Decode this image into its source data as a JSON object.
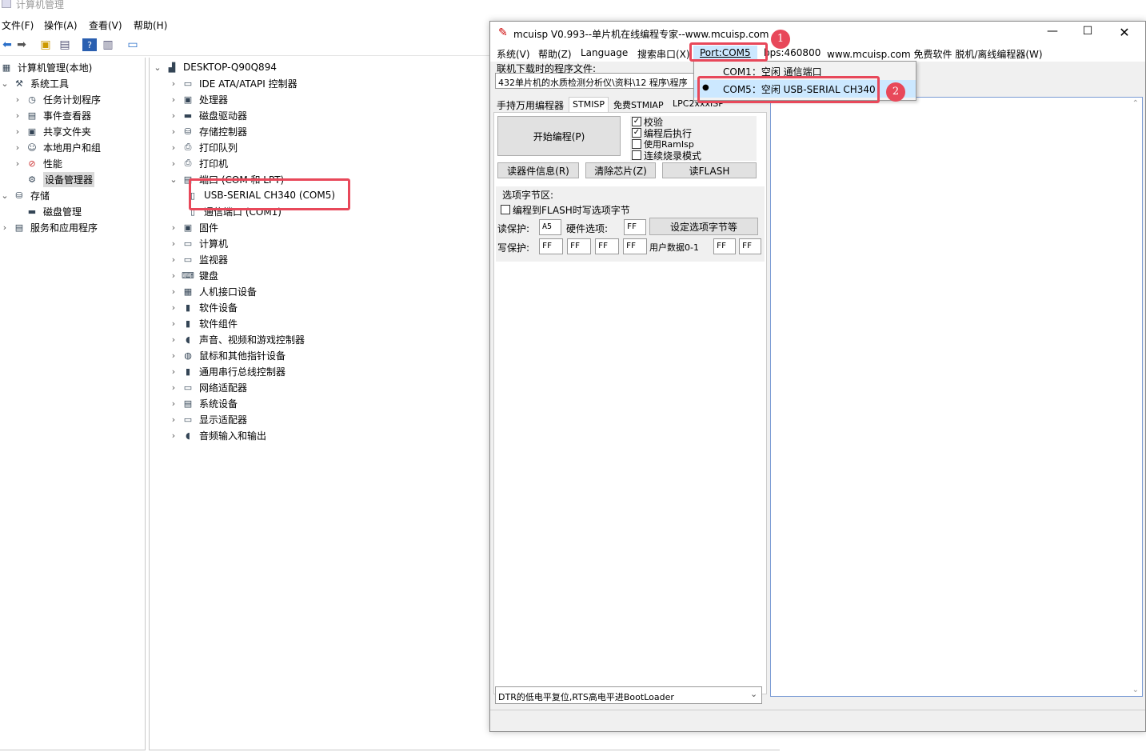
{
  "cm": {
    "title": "计算机管理",
    "menu": [
      "文件(F)",
      "操作(A)",
      "查看(V)",
      "帮助(H)"
    ],
    "left_tree": [
      {
        "label": "计算机管理(本地)",
        "icon": "computer-management-icon"
      },
      {
        "label": "系统工具",
        "icon": "tools-icon"
      },
      {
        "label": "任务计划程序",
        "icon": "clock-icon"
      },
      {
        "label": "事件查看器",
        "icon": "event-viewer-icon"
      },
      {
        "label": "共享文件夹",
        "icon": "shared-folder-icon"
      },
      {
        "label": "本地用户和组",
        "icon": "users-icon"
      },
      {
        "label": "性能",
        "icon": "performance-icon"
      },
      {
        "label": "设备管理器",
        "icon": "device-manager-icon"
      },
      {
        "label": "存储",
        "icon": "storage-icon"
      },
      {
        "label": "磁盘管理",
        "icon": "disk-management-icon"
      },
      {
        "label": "服务和应用程序",
        "icon": "services-icon"
      }
    ],
    "device_tree": {
      "root": "DESKTOP-Q90Q894",
      "items": [
        "IDE ATA/ATAPI 控制器",
        "处理器",
        "磁盘驱动器",
        "存储控制器",
        "打印队列",
        "打印机",
        "端口 (COM 和 LPT)",
        "USB-SERIAL CH340 (COM5)",
        "通信端口 (COM1)",
        "固件",
        "计算机",
        "监视器",
        "键盘",
        "人机接口设备",
        "软件设备",
        "软件组件",
        "声音、视频和游戏控制器",
        "鼠标和其他指针设备",
        "通用串行总线控制器",
        "网络适配器",
        "系统设备",
        "显示适配器",
        "音频输入和输出"
      ]
    }
  },
  "mc": {
    "title": "mcuisp V0.993--单片机在线编程专家--www.mcuisp.com",
    "menu": {
      "system": "系统(V)",
      "help": "帮助(Z)",
      "language": "Language",
      "search_port": "搜索串口(X)",
      "port": "Port:COM5",
      "bps": "bps:460800",
      "website": "www.mcuisp.com 免费软件 脱机/离线编程器(W)"
    },
    "file_label": "联机下载时的程序文件:",
    "file_path": "432单片机的水质检测分析仪\\资料\\12 程序\\程序",
    "tabs": [
      "手持万用编程器",
      "STMISP",
      "免费STMIAP",
      "LPC2xxxISP"
    ],
    "start_button": "开始编程(P)",
    "options": [
      {
        "label": "校验",
        "checked": true
      },
      {
        "label": "编程后执行",
        "checked": true
      },
      {
        "label": "使用RamIsp",
        "checked": false
      },
      {
        "label": "连续烧录模式",
        "checked": false
      }
    ],
    "read_info_button": "读器件信息(R)",
    "erase_button": "清除芯片(Z)",
    "read_flash_button": "读FLASH",
    "option_bytes": {
      "section_label": "选项字节区:",
      "write_to_flash": "编程到FLASH时写选项字节",
      "read_protect_label": "读保护:",
      "read_protect_value": "A5",
      "hw_option_label": "硬件选项:",
      "hw_option_value": "FF",
      "set_button": "设定选项字节等",
      "write_protect_label": "写保护:",
      "write_protect_values": [
        "FF",
        "FF",
        "FF",
        "FF"
      ],
      "user_data_label": "用户数据0-1",
      "user_data_values": [
        "FF",
        "FF"
      ]
    },
    "bootloader_select": "DTR的低电平复位,RTS高电平进BootLoader"
  },
  "dropdown": {
    "items": [
      {
        "label": "COM1：空闲 通信端口",
        "selected": false
      },
      {
        "label": "COM5：空闲 USB-SERIAL CH340",
        "selected": true
      }
    ]
  },
  "annotations": {
    "badge1": "1",
    "badge2": "2"
  },
  "colors": {
    "highlight": "#e8485a",
    "menu_hover": "#cce8ff",
    "selected_tree": "#d9d9d9"
  }
}
